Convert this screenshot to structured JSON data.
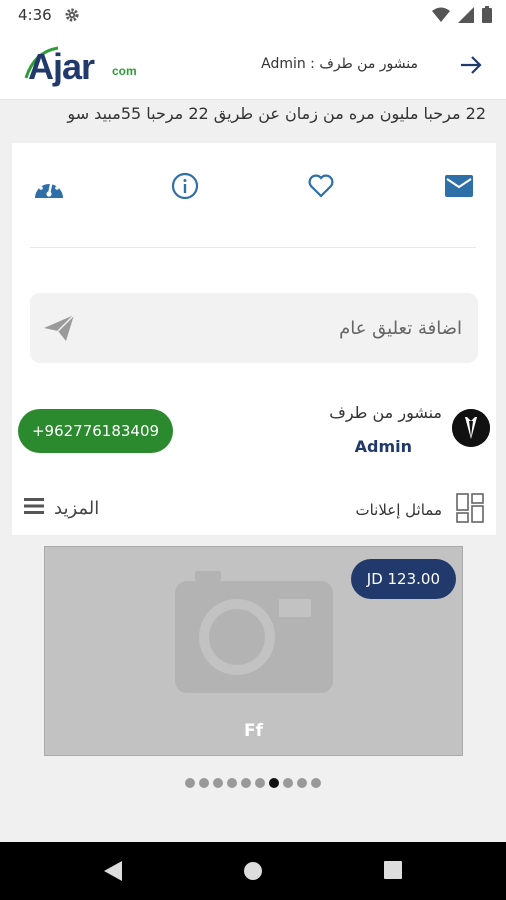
{
  "status_bar": {
    "time": "4:36"
  },
  "header": {
    "logo_main": "Ajar",
    "logo_suffix": "com",
    "posted_by": "منشور من طرف : Admin"
  },
  "title": "22 مرحبا مليون مره من زمان عن طريق 22 مرحبا 55مبيد سو",
  "comment": {
    "placeholder": "اضافة تعليق عام"
  },
  "author": {
    "label": "منشور من طرف",
    "name": "Admin",
    "phone": "+962776183409"
  },
  "similar_label": "مماثل إعلانات",
  "more_label": "المزيد",
  "gallery": {
    "caption": "Ff",
    "price": "JD 123.00",
    "dot_count": 10,
    "active_dot": 6
  },
  "colors": {
    "brand_navy": "#213a6b",
    "brand_green": "#2e9d3a",
    "phone_button": "#2b8a2e",
    "icon_blue": "#2f6fa8"
  }
}
